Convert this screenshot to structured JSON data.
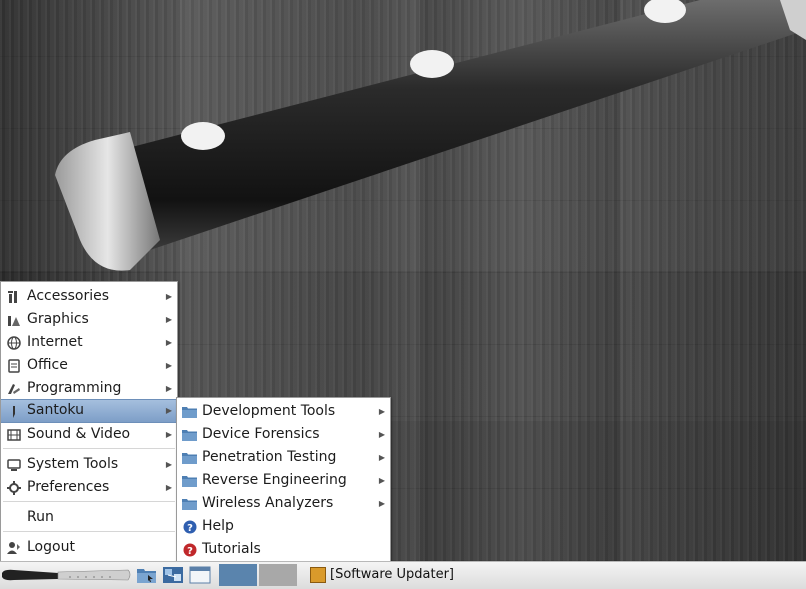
{
  "main_menu": {
    "items": [
      {
        "label": "Accessories",
        "icon": "accessories-icon",
        "submenu": true
      },
      {
        "label": "Graphics",
        "icon": "graphics-icon",
        "submenu": true
      },
      {
        "label": "Internet",
        "icon": "internet-globe-icon",
        "submenu": true
      },
      {
        "label": "Office",
        "icon": "office-document-icon",
        "submenu": true
      },
      {
        "label": "Programming",
        "icon": "programming-icon",
        "submenu": true
      },
      {
        "label": "Santoku",
        "icon": "santoku-knife-icon",
        "submenu": true,
        "highlighted": true
      },
      {
        "label": "Sound & Video",
        "icon": "film-strip-icon",
        "submenu": true
      },
      {
        "label": "System Tools",
        "icon": "monitor-icon",
        "submenu": true
      },
      {
        "label": "Preferences",
        "icon": "gear-icon",
        "submenu": true
      },
      {
        "label": "Run",
        "icon": "",
        "submenu": false
      },
      {
        "label": "Logout",
        "icon": "logout-icon",
        "submenu": false
      }
    ]
  },
  "santoku_submenu": {
    "items": [
      {
        "label": "Development Tools",
        "icon": "folder-icon",
        "submenu": true
      },
      {
        "label": "Device Forensics",
        "icon": "folder-icon",
        "submenu": true
      },
      {
        "label": "Penetration Testing",
        "icon": "folder-icon",
        "submenu": true
      },
      {
        "label": "Reverse Engineering",
        "icon": "folder-icon",
        "submenu": true
      },
      {
        "label": "Wireless Analyzers",
        "icon": "folder-icon",
        "submenu": true
      },
      {
        "label": "Help",
        "icon": "help-icon",
        "submenu": false
      },
      {
        "label": "Tutorials",
        "icon": "tutorials-icon",
        "submenu": false
      }
    ]
  },
  "taskbar": {
    "start_icon": "santoku-knife-logo",
    "launchers": [
      "file-manager-icon",
      "network-icon",
      "terminal-window-icon"
    ],
    "desktops": [
      "desktop-1",
      "desktop-2"
    ],
    "active_desktop": 1,
    "task_label": "[Software Updater]",
    "task_icon": "software-updater-icon"
  },
  "colors": {
    "highlight": "#7d9ec7",
    "menu_bg": "#ffffff",
    "taskbar_bg": "#e6e6e6"
  }
}
